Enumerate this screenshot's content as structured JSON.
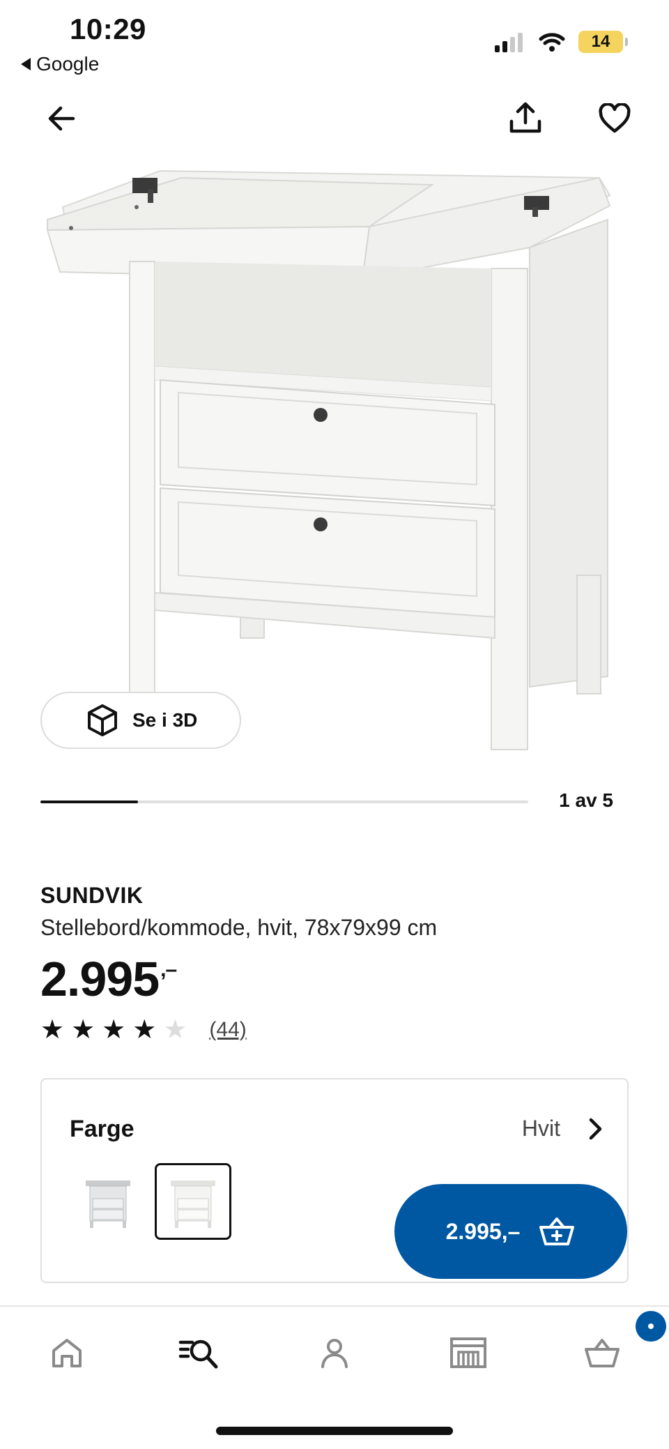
{
  "status_bar": {
    "time": "10:29",
    "back_app": "Google",
    "battery": "14"
  },
  "nav": {
    "back_icon": "arrow-left-icon",
    "share_icon": "share-icon",
    "favorite_icon": "heart-icon"
  },
  "gallery": {
    "view_3d_label": "Se i 3D",
    "counter": "1 av 5",
    "current_index": 1,
    "total": 5
  },
  "product": {
    "brand": "SUNDVIK",
    "description": "Stellebord/kommode, hvit, 78x79x99 cm",
    "price_main": "2.995",
    "price_suffix": ",–",
    "rating": 4,
    "rating_max": 5,
    "review_count": "(44)"
  },
  "color_selector": {
    "label": "Farge",
    "selected_value": "Hvit",
    "options": [
      {
        "name": "grey-white variant",
        "selected": false
      },
      {
        "name": "Hvit",
        "selected": true
      }
    ]
  },
  "add_to_cart": {
    "price_label": "2.995,–",
    "icon": "basket-add-icon",
    "accent_color": "#0058a3"
  },
  "tabbar": {
    "items": [
      "home-icon",
      "search-icon",
      "profile-icon",
      "store-icon",
      "cart-icon"
    ],
    "cart_badge_color": "#0058a3"
  }
}
